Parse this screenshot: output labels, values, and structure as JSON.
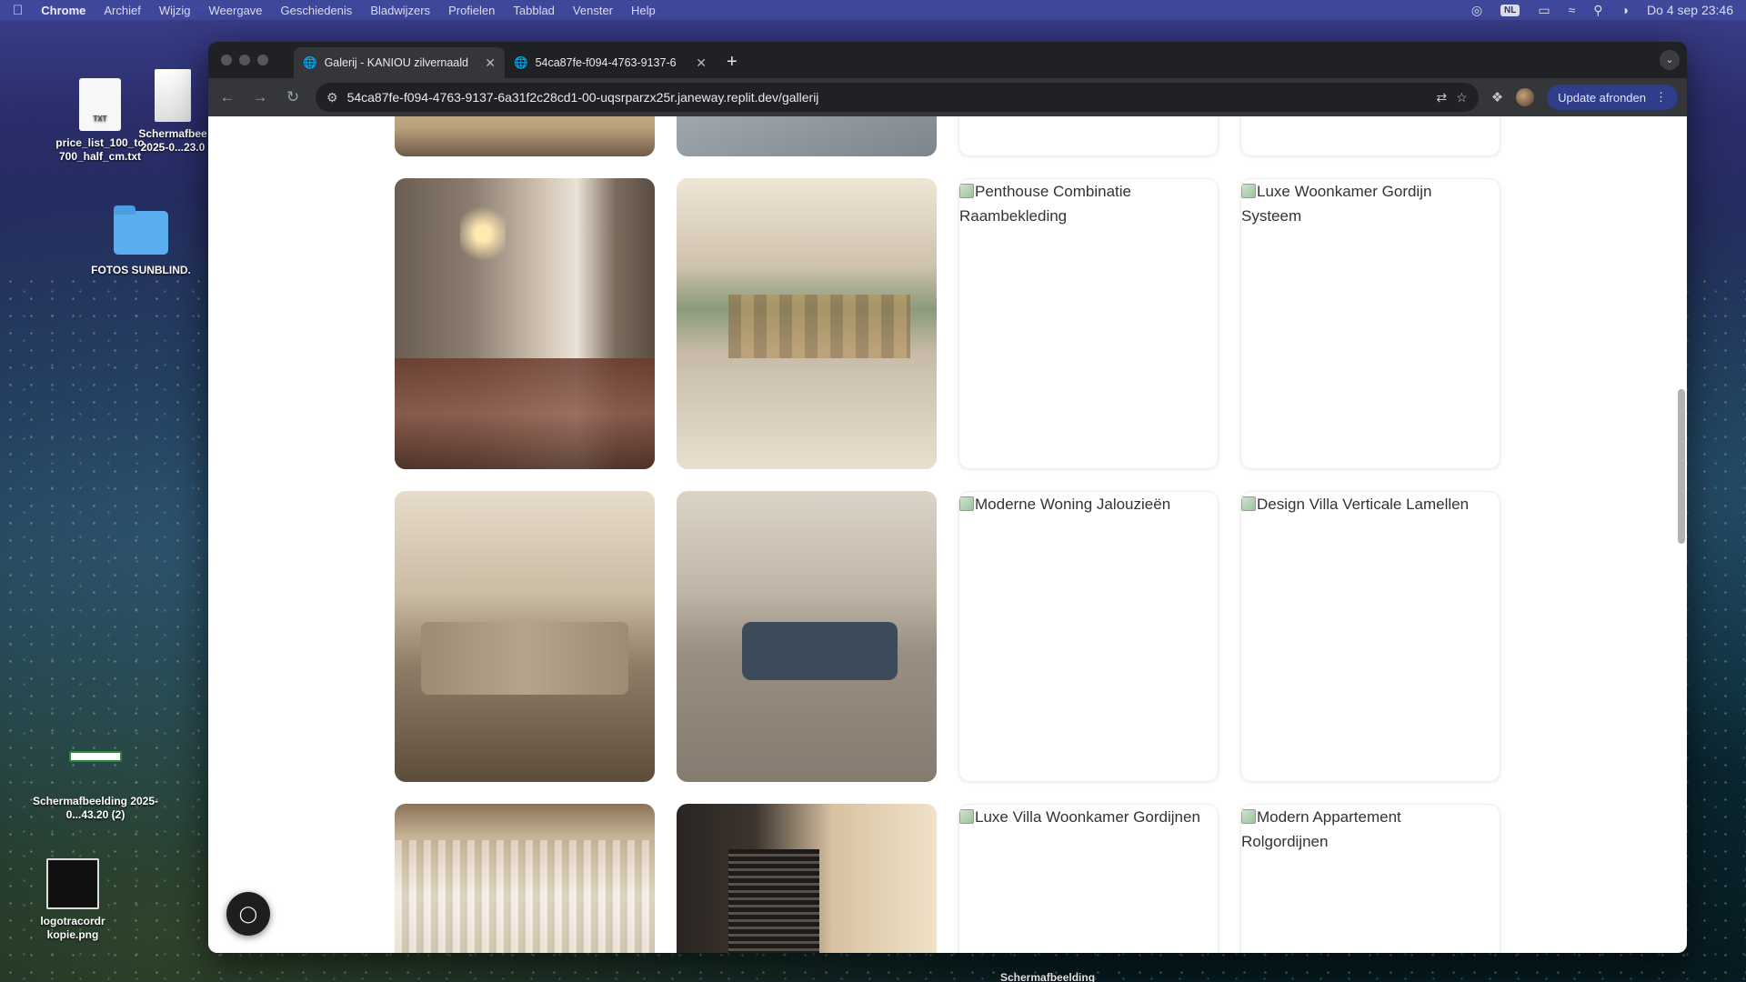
{
  "menubar": {
    "app_name": "Chrome",
    "items": [
      "Archief",
      "Wijzig",
      "Weergave",
      "Geschiedenis",
      "Bladwijzers",
      "Profielen",
      "Tabblad",
      "Venster",
      "Help"
    ],
    "input_badge": "NL",
    "clock": "Do 4 sep  23:46"
  },
  "desktop": {
    "icons": [
      {
        "label": "price_list_100_to 700_half_cm.txt",
        "file_tag": "TXT"
      },
      {
        "label": "Schermafbee 2025-0...23.0"
      },
      {
        "label": "FOTOS SUNBLIND."
      },
      {
        "label": "Schermafbeelding 2025-0...43.20 (2)"
      },
      {
        "label": "logotracordr kopie.png"
      },
      {
        "label": "Schermafbeelding"
      }
    ]
  },
  "browser": {
    "tabs": [
      {
        "title": "Galerij - KANIOU zilvernaald",
        "active": true
      },
      {
        "title": "54ca87fe-f094-4763-9137-6",
        "active": false
      }
    ],
    "url": "54ca87fe-f094-4763-9137-6a31f2c28cd1-00-uqsrparzx25r.janeway.replit.dev/gallerij",
    "update_label": "Update afronden"
  },
  "gallery": {
    "rows": [
      [
        {
          "type": "photo",
          "name": "photo-floor"
        },
        {
          "type": "photo",
          "name": "photo-tiles"
        },
        {
          "type": "broken",
          "alt": ""
        },
        {
          "type": "broken",
          "alt": ""
        }
      ],
      [
        {
          "type": "photo",
          "name": "photo-dining-curtains"
        },
        {
          "type": "photo",
          "name": "photo-kitchen-blinds"
        },
        {
          "type": "broken",
          "alt": "Penthouse Combinatie Raambekleding"
        },
        {
          "type": "broken",
          "alt": "Luxe Woonkamer Gordijn Systeem"
        }
      ],
      [
        {
          "type": "photo",
          "name": "photo-living-room"
        },
        {
          "type": "photo",
          "name": "photo-living-sofa"
        },
        {
          "type": "broken",
          "alt": "Moderne Woning Jalouzieën"
        },
        {
          "type": "broken",
          "alt": "Design Villa Verticale Lamellen"
        }
      ],
      [
        {
          "type": "photo",
          "name": "photo-curtains"
        },
        {
          "type": "photo",
          "name": "photo-blinds"
        },
        {
          "type": "broken",
          "alt": "Luxe Villa Woonkamer Gordijnen"
        },
        {
          "type": "broken",
          "alt": "Modern Appartement Rolgordijnen"
        }
      ]
    ]
  }
}
